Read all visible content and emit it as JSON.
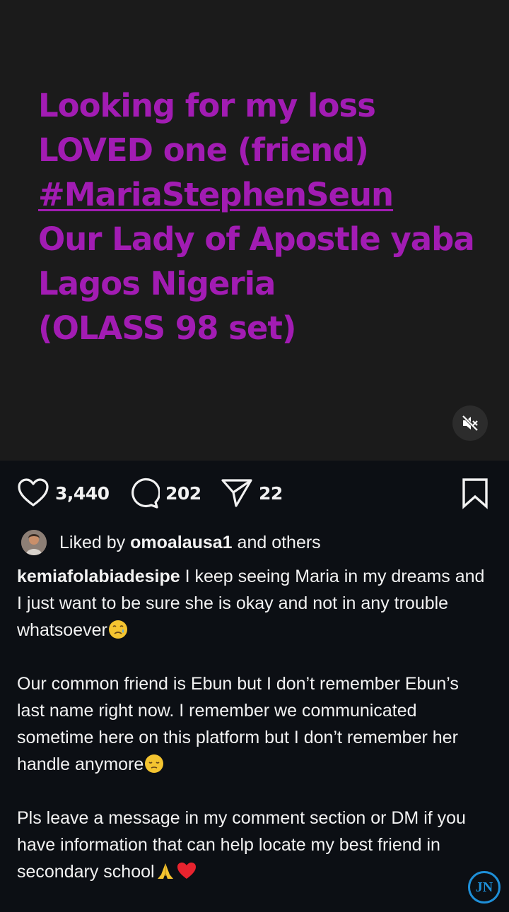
{
  "post": {
    "media_text": {
      "line1": "Looking for my loss",
      "line2": "LOVED one (friend)",
      "line3": "#MariaStephenSeun",
      "line4": "Our Lady of Apostle yaba",
      "line5": "Lagos Nigeria",
      "line6": "(OLASS 98 set)"
    },
    "media_text_color": "#a21cb3",
    "mute_icon": "speaker-muted-icon",
    "likes": "3,440",
    "comments": "202",
    "shares": "22",
    "liked_by": {
      "prefix": "Liked by",
      "user": "omoalausa1",
      "suffix": "and others"
    },
    "caption": {
      "username": "kemiafolabiadesipe",
      "p1": "I keep seeing Maria in my dreams and I just want to be sure she is okay and not in any trouble whatsoever",
      "p2": "Our common friend is Ebun but I don’t remember Ebun’s last name right now. I remember we communicated sometime here on this platform but I don’t remember her handle anymore",
      "p3": "Pls leave a message in my comment section or DM if you have information that can help locate my best friend in secondary school"
    },
    "watermark": "JN"
  }
}
